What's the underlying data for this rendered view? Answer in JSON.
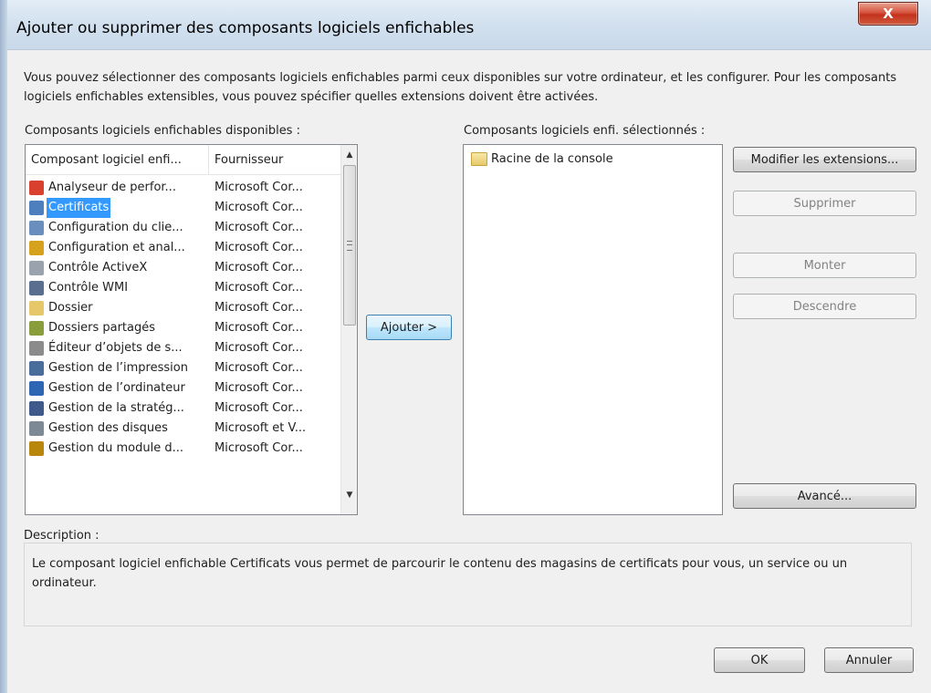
{
  "window": {
    "title": "Ajouter ou supprimer des composants logiciels enfichables",
    "close_glyph": "X"
  },
  "intro": "Vous pouvez sélectionner des composants logiciels enfichables parmi ceux disponibles sur votre ordinateur, et les configurer. Pour les composants logiciels enfichables extensibles, vous pouvez spécifier quelles extensions doivent être activées.",
  "available": {
    "label": "Composants logiciels enfichables disponibles :",
    "columns": [
      "Composant logiciel enfi...",
      "Fournisseur"
    ],
    "items": [
      {
        "name": "Analyseur de perfor...",
        "vendor": "Microsoft Cor...",
        "icon": "performance-icon",
        "color": "#d9412e"
      },
      {
        "name": "Certificats",
        "vendor": "Microsoft Cor...",
        "icon": "certificate-icon",
        "color": "#4d7fbf",
        "selected": true
      },
      {
        "name": "Configuration du clie...",
        "vendor": "Microsoft Cor...",
        "icon": "client-config-icon",
        "color": "#6a8fbf"
      },
      {
        "name": "Configuration et anal...",
        "vendor": "Microsoft Cor...",
        "icon": "security-config-icon",
        "color": "#d6a21e"
      },
      {
        "name": "Contrôle ActiveX",
        "vendor": "Microsoft Cor...",
        "icon": "activex-icon",
        "color": "#9aa3ad"
      },
      {
        "name": "Contrôle WMI",
        "vendor": "Microsoft Cor...",
        "icon": "wmi-icon",
        "color": "#5a6f8f"
      },
      {
        "name": "Dossier",
        "vendor": "Microsoft Cor...",
        "icon": "folder-icon",
        "color": "#e6c86a"
      },
      {
        "name": "Dossiers partagés",
        "vendor": "Microsoft Cor...",
        "icon": "shared-folders-icon",
        "color": "#8a9d3c"
      },
      {
        "name": "Éditeur d’objets de s...",
        "vendor": "Microsoft Cor...",
        "icon": "policy-editor-icon",
        "color": "#8b8b8b"
      },
      {
        "name": "Gestion de l’impression",
        "vendor": "Microsoft Cor...",
        "icon": "print-management-icon",
        "color": "#4a6e9c"
      },
      {
        "name": "Gestion de l’ordinateur",
        "vendor": "Microsoft Cor...",
        "icon": "computer-management-icon",
        "color": "#2f66b3"
      },
      {
        "name": "Gestion de la stratég...",
        "vendor": "Microsoft Cor...",
        "icon": "group-policy-icon",
        "color": "#3d5a8a"
      },
      {
        "name": "Gestion des disques",
        "vendor": "Microsoft et V...",
        "icon": "disk-management-icon",
        "color": "#7d8a96"
      },
      {
        "name": "Gestion du module d...",
        "vendor": "Microsoft Cor...",
        "icon": "tpm-management-icon",
        "color": "#b8860b"
      }
    ]
  },
  "add_button": "Ajouter >",
  "selected": {
    "label": "Composants logiciels enfi. sélectionnés :",
    "items": [
      {
        "name": "Racine de la console",
        "icon": "folder-icon"
      }
    ]
  },
  "side_buttons": {
    "edit_extensions": "Modifier les extensions...",
    "remove": "Supprimer",
    "move_up": "Monter",
    "move_down": "Descendre",
    "advanced": "Avancé..."
  },
  "description": {
    "label": "Description :",
    "text": "Le composant logiciel enfichable Certificats vous permet de parcourir le contenu des magasins de certificats pour vous, un service ou un ordinateur."
  },
  "footer": {
    "ok": "OK",
    "cancel": "Annuler"
  }
}
